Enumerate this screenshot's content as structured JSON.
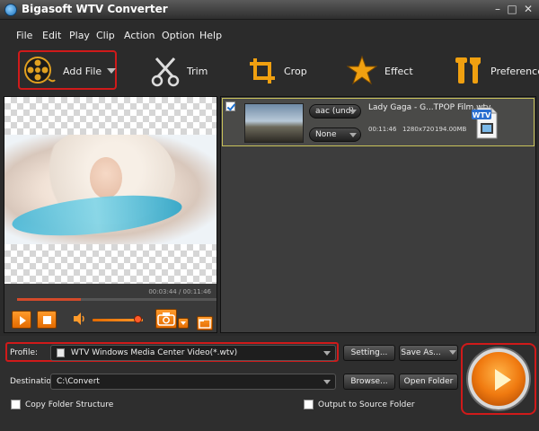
{
  "window": {
    "title": "Bigasoft WTV Converter"
  },
  "menu": {
    "items": [
      "File",
      "Edit",
      "Play",
      "Clip",
      "Action",
      "Option",
      "Help"
    ]
  },
  "toolbar": {
    "add_file": "Add File",
    "trim": "Trim",
    "crop": "Crop",
    "effect": "Effect",
    "preference": "Preference"
  },
  "preview": {
    "time": "00:03:44 / 00:11:46",
    "progress": 0.32,
    "volume": 0.9
  },
  "file_list": {
    "items": [
      {
        "name": "Lady Gaga - G...TPOP Film.wtv",
        "audio": "aac (und)",
        "subtitle": "None",
        "duration": "00:11:46",
        "resolution": "1280x720",
        "size": "194.00MB",
        "checked": true,
        "badge": "WTV"
      }
    ]
  },
  "bottom": {
    "profile_label": "Profile:",
    "profile_value": "WTV Windows Media Center Video(*.wtv)",
    "setting": "Setting...",
    "save_as": "Save As...",
    "destination_label": "Destination:",
    "destination_value": "C:\\Convert",
    "browse": "Browse...",
    "open_folder": "Open Folder",
    "copy_folder": "Copy Folder Structure",
    "output_source": "Output to Source Folder"
  },
  "colors": {
    "highlight": "#d01a1a",
    "accent": "#f07a10",
    "background": "#2b2b2b"
  }
}
